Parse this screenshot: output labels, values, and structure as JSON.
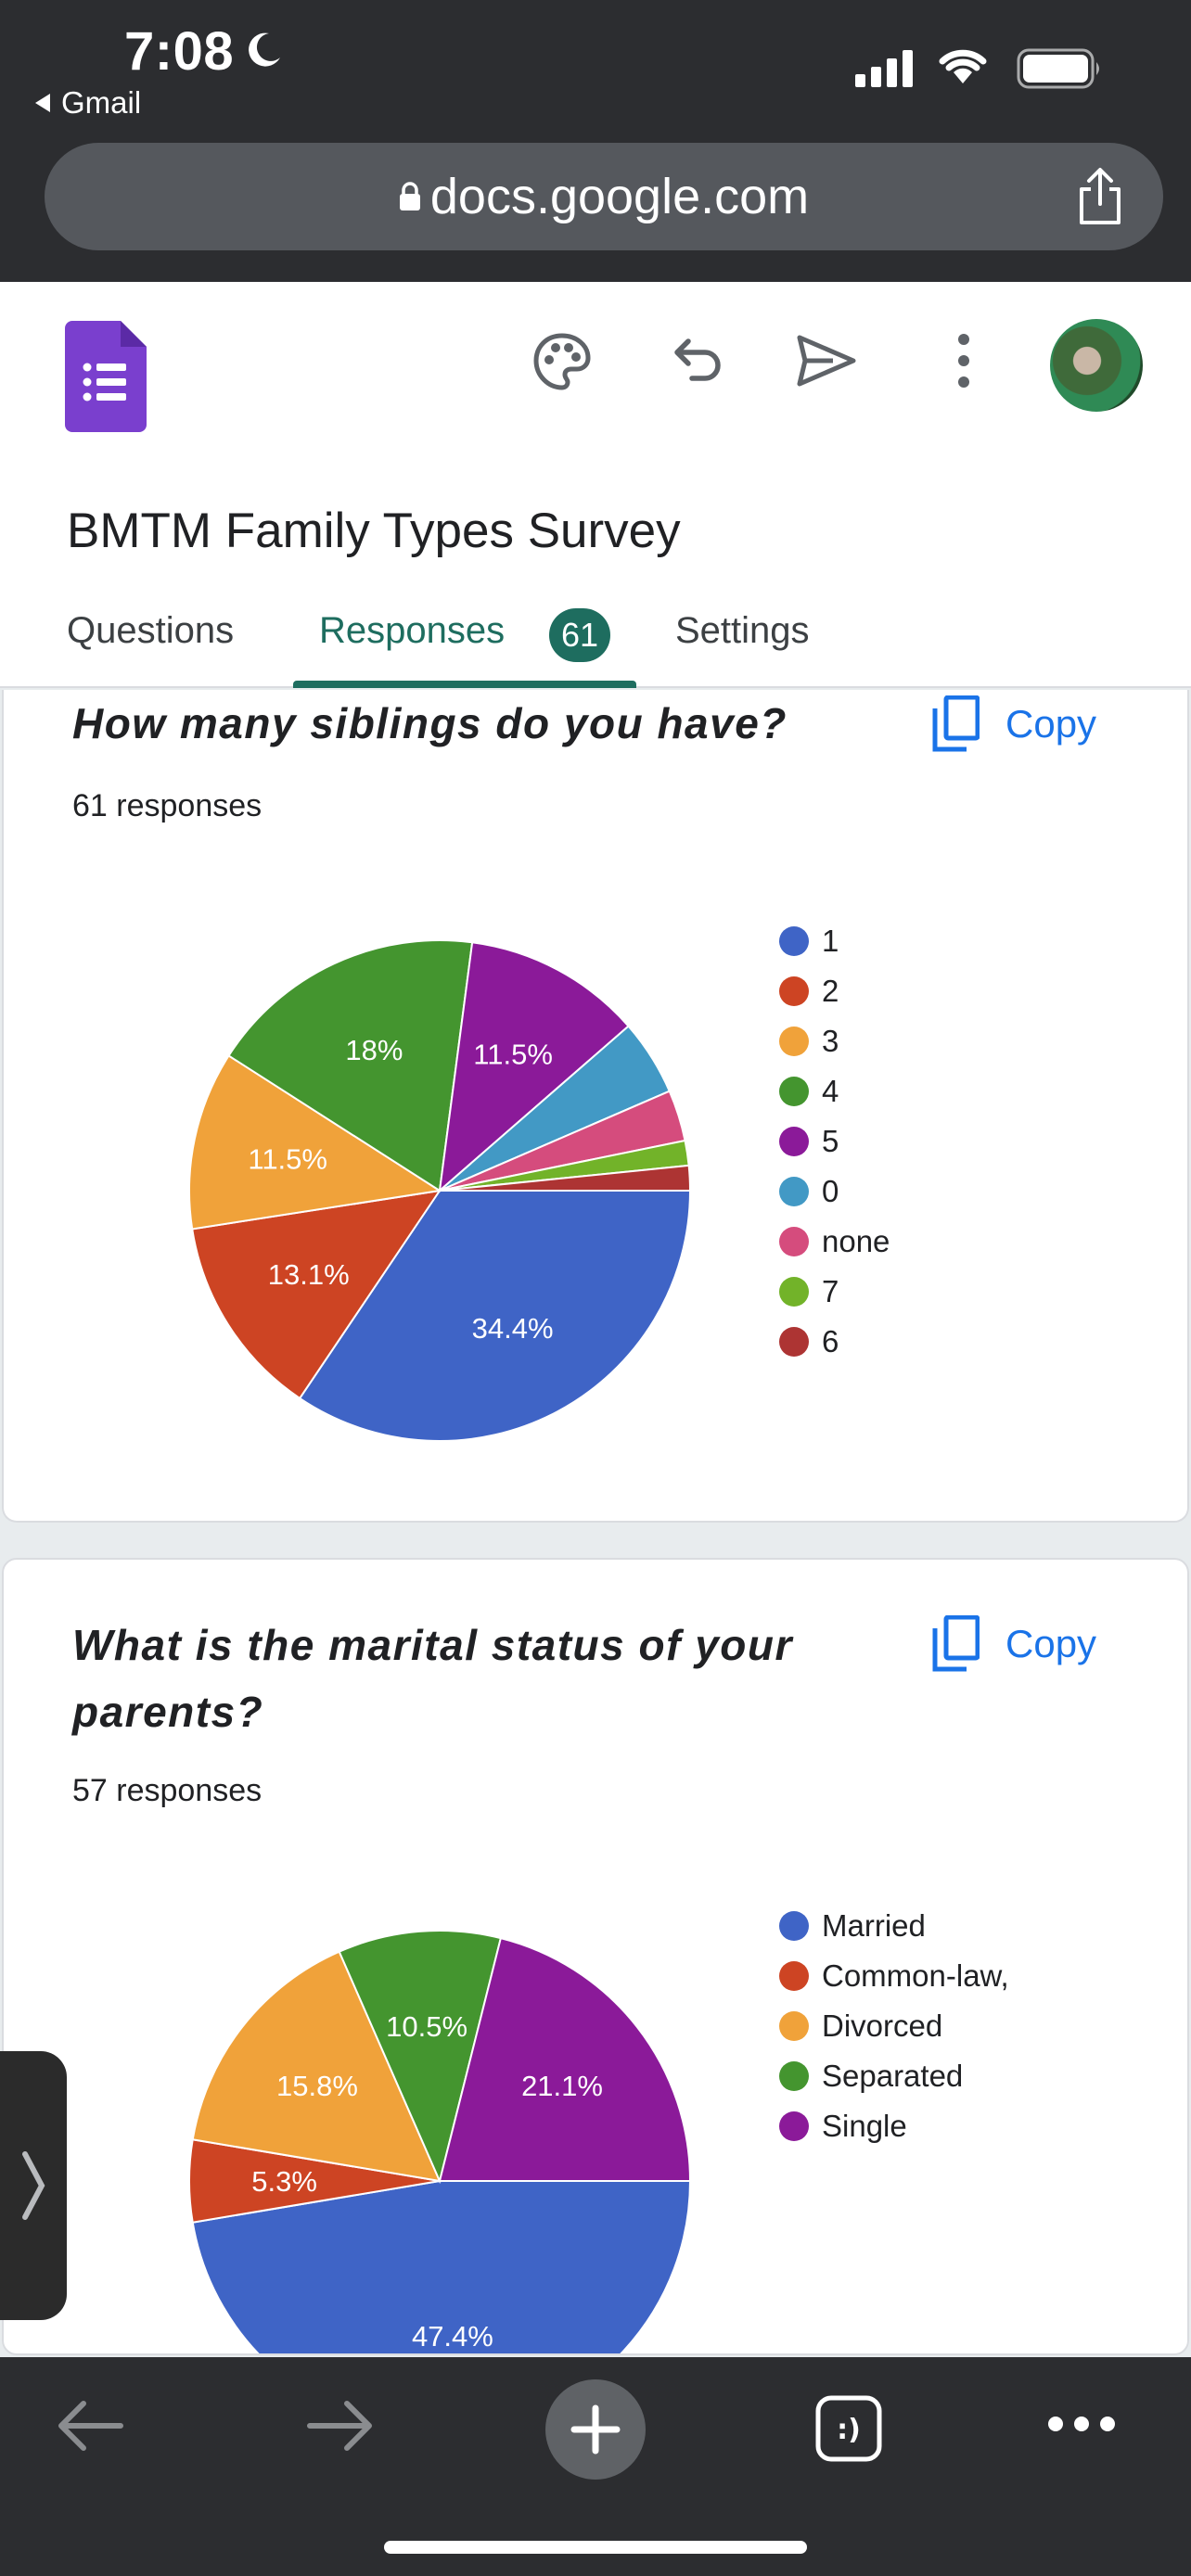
{
  "status_bar": {
    "time": "7:08",
    "back_app": "Gmail",
    "icons": [
      "moon-icon",
      "signal-icon",
      "wifi-icon",
      "battery-icon"
    ]
  },
  "browser": {
    "url": "docs.google.com",
    "icons": [
      "lock-icon",
      "share-icon"
    ]
  },
  "header": {
    "form_title": "BMTM Family Types Survey",
    "toolbar_icons": [
      "palette-icon",
      "undo-icon",
      "send-icon",
      "more-vert-icon",
      "avatar"
    ],
    "tabs": [
      {
        "label": "Questions"
      },
      {
        "label": "Responses",
        "badge": "61"
      },
      {
        "label": "Settings"
      }
    ],
    "active_tab": "Responses",
    "accent_color": "#1e6d5f"
  },
  "cards": [
    {
      "question": "How many siblings do you have?",
      "responses": "61 responses",
      "copy_label": "Copy",
      "legend": [
        {
          "label": "1",
          "color": "#3f64c6"
        },
        {
          "label": "2",
          "color": "#cd4423"
        },
        {
          "label": "3",
          "color": "#f0a23a"
        },
        {
          "label": "4",
          "color": "#44952f"
        },
        {
          "label": "5",
          "color": "#8b1a99"
        },
        {
          "label": "0",
          "color": "#4299c5"
        },
        {
          "label": "none",
          "color": "#d54c7d"
        },
        {
          "label": "7",
          "color": "#72b329"
        },
        {
          "label": "6",
          "color": "#ad3433"
        }
      ]
    },
    {
      "question": "What is the marital status of your parents?",
      "responses": "57 responses",
      "copy_label": "Copy",
      "legend": [
        {
          "label": "Married",
          "color": "#3f64c6"
        },
        {
          "label": "Common-law,",
          "color": "#cd4423"
        },
        {
          "label": "Divorced",
          "color": "#f0a23a"
        },
        {
          "label": "Separated",
          "color": "#44952f"
        },
        {
          "label": "Single",
          "color": "#8b1a99"
        }
      ]
    }
  ],
  "chart_data": [
    {
      "type": "pie",
      "categories": [
        "1",
        "2",
        "3",
        "4",
        "5",
        "0",
        "none",
        "7",
        "6"
      ],
      "values": [
        34.4,
        13.1,
        11.5,
        18.0,
        11.5,
        4.9,
        3.3,
        1.6,
        1.6
      ],
      "labels": [
        "34.4%",
        "13.1%",
        "11.5%",
        "18%",
        "11.5%",
        "",
        "",
        "",
        ""
      ],
      "colors": [
        "#3f64c6",
        "#cd4423",
        "#f0a23a",
        "#44952f",
        "#8b1a99",
        "#4299c5",
        "#d54c7d",
        "#72b329",
        "#ad3433"
      ],
      "legend_position": "right"
    },
    {
      "type": "pie",
      "categories": [
        "Married",
        "Common-law,",
        "Divorced",
        "Separated",
        "Single"
      ],
      "values": [
        47.4,
        5.3,
        15.8,
        10.5,
        21.1
      ],
      "labels": [
        "47.4%",
        "5.3%",
        "15.8%",
        "10.5%",
        "21.1%"
      ],
      "colors": [
        "#3f64c6",
        "#cd4423",
        "#f0a23a",
        "#44952f",
        "#8b1a99"
      ],
      "legend_position": "right"
    }
  ],
  "bottom_bar": {
    "icons": [
      "back-arrow-icon",
      "forward-arrow-icon",
      "new-tab-plus-icon",
      "tabs-icon",
      "more-horiz-icon"
    ]
  }
}
